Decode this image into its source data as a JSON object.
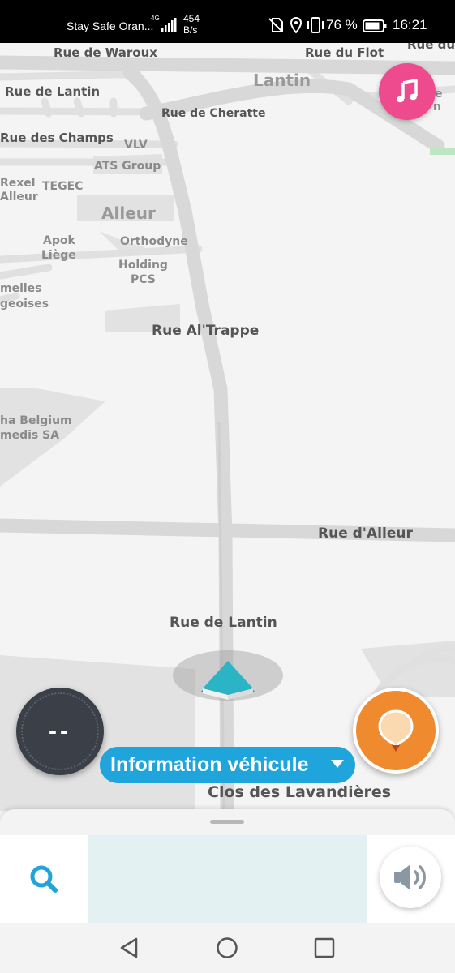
{
  "status_bar": {
    "carrier": "Stay Safe Oran...",
    "network_type": "4G",
    "net_speed_value": "454",
    "net_speed_unit": "B/s",
    "battery_percent": "76 %",
    "time": "16:21"
  },
  "map": {
    "street_labels": [
      "Rue de Waroux",
      "Rue du Flot",
      "Rue du",
      "Rue de Lantin",
      "Rue de Cheratte",
      "Rue des Champs",
      "Rue Al'Trappe",
      "Rue d'Alleur",
      "Rue de Lantin"
    ],
    "place_labels": [
      "Lantin",
      "VLV",
      "ATS Group",
      "Rexel",
      "Alleur",
      "TEGEC",
      "Alleur",
      "Apok",
      "Liège",
      "Orthodyne",
      "Holding",
      "PCS",
      "melles",
      "geoises",
      "ha Belgium",
      "medis SA",
      "e",
      "n"
    ]
  },
  "controls": {
    "speed_display": "--",
    "vehicle_info_label": "Information véhicule",
    "current_street": "Clos des Lavandières"
  },
  "colors": {
    "music_button": "#ee4b8f",
    "report_button": "#f08a2f",
    "vehicle_pill": "#1fa5dc",
    "position_arrow": "#2bb3c6",
    "search_field_bg": "#e3f1f3"
  },
  "icons": {
    "music": "music-note-icon",
    "report": "report-pin-icon",
    "search": "search-icon",
    "sound": "speaker-icon",
    "back": "back-triangle-icon",
    "home": "home-circle-icon",
    "recents": "recents-square-icon"
  }
}
